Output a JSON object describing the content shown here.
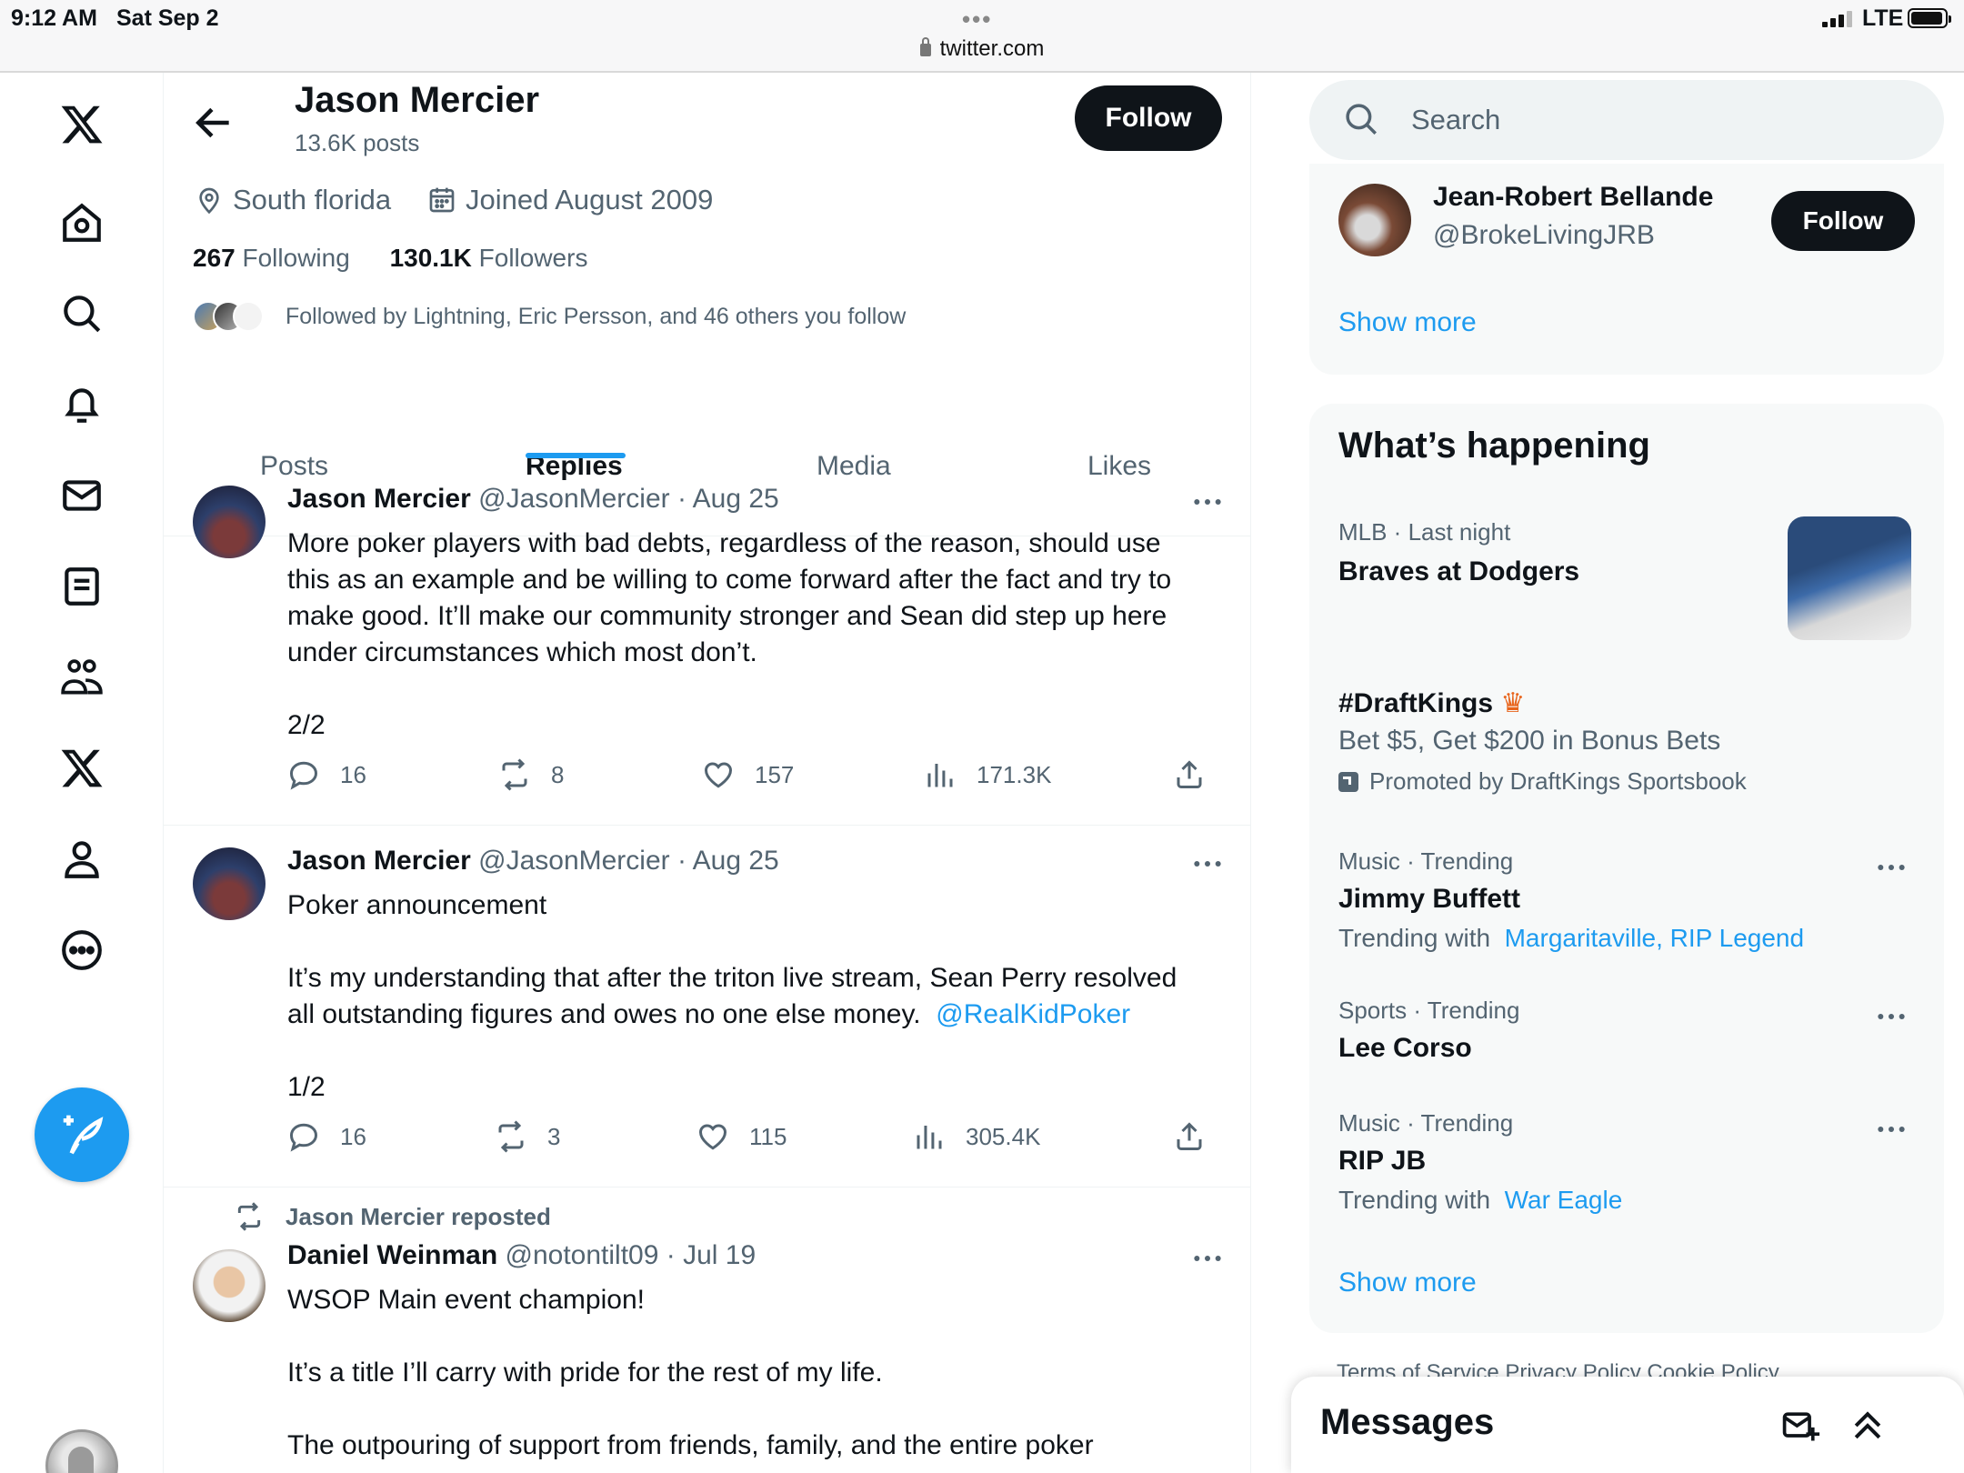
{
  "status_bar": {
    "time": "9:12 AM",
    "date": "Sat Sep 2",
    "url": "twitter.com",
    "network": "LTE"
  },
  "nav": {
    "icons": [
      "x-logo-icon",
      "home-icon",
      "search-icon",
      "notifications-icon",
      "messages-icon",
      "lists-icon",
      "communities-icon",
      "premium-x-icon",
      "profile-icon",
      "more-icon",
      "compose-icon"
    ]
  },
  "profile": {
    "name": "Jason Mercier",
    "posts_count": "13.6K posts",
    "follow_label": "Follow",
    "location": "South florida",
    "joined": "Joined August 2009",
    "following_count": "267",
    "following_label": "Following",
    "followers_count": "130.1K",
    "followers_label": "Followers",
    "followed_by": "Followed by Lightning, Eric Persson, and 46 others you follow"
  },
  "tabs": [
    {
      "label": "Posts",
      "active": false
    },
    {
      "label": "Replies",
      "active": true
    },
    {
      "label": "Media",
      "active": false
    },
    {
      "label": "Likes",
      "active": false
    }
  ],
  "tweets": [
    {
      "name": "Jason Mercier",
      "handle": "@JasonMercier",
      "date": "· Aug 25",
      "lines": [
        "More poker players with bad debts, regardless of the reason, should use",
        "this as an example and be willing to come forward after the fact and try to",
        "make good. It’ll make our community stronger and Sean did step up here",
        "under circumstances which most don’t.",
        "",
        "2/2"
      ],
      "replies": "16",
      "reposts": "8",
      "likes": "157",
      "views": "171.3K"
    },
    {
      "name": "Jason Mercier",
      "handle": "@JasonMercier",
      "date": "· Aug 25",
      "lines": [
        "Poker announcement",
        "",
        "It’s my understanding that after the triton live stream, Sean Perry resolved",
        "all outstanding figures and owes no one else money."
      ],
      "mention": "@RealKidPoker",
      "lines2": [
        "",
        "1/2"
      ],
      "replies": "16",
      "reposts": "3",
      "likes": "115",
      "views": "305.4K"
    },
    {
      "repost_by": "Jason Mercier reposted",
      "name": "Daniel Weinman",
      "handle": "@notontilt09",
      "date": "· Jul 19",
      "lines": [
        "WSOP Main event champion!",
        "",
        "It’s a title I’ll carry with pride for the rest of my life.",
        "",
        "The outpouring of support from friends, family, and the entire poker"
      ]
    }
  ],
  "search": {
    "placeholder": "Search"
  },
  "who_to_follow": {
    "name": "Jean-Robert Bellande",
    "handle": "@BrokeLivingJRB",
    "follow_label": "Follow",
    "show_more": "Show more"
  },
  "whats_happening": {
    "title": "What’s happening",
    "trends": [
      {
        "meta": "MLB · Last night",
        "title": "Braves at Dodgers"
      },
      {
        "title": "#DraftKings",
        "sub": "Bet $5, Get $200 in Bonus Bets",
        "promoted": "Promoted by DraftKings Sportsbook"
      },
      {
        "meta": "Music · Trending",
        "title": "Jimmy Buffett",
        "sub_prefix": "Trending with",
        "links": [
          "Margaritaville",
          "RIP Legend"
        ]
      },
      {
        "meta": "Sports · Trending",
        "title": "Lee Corso"
      },
      {
        "meta": "Music · Trending",
        "title": "RIP JB",
        "sub_prefix": "Trending with",
        "links": [
          "War Eagle"
        ]
      }
    ],
    "show_more": "Show more"
  },
  "footer_peek": "Terms of Service   Privacy Policy   Cookie Policy",
  "messages_drawer": {
    "title": "Messages"
  },
  "colors": {
    "accent": "#1d9bf0",
    "text": "#0f1419",
    "secondary": "#536471",
    "panel": "#f7f9f9"
  }
}
